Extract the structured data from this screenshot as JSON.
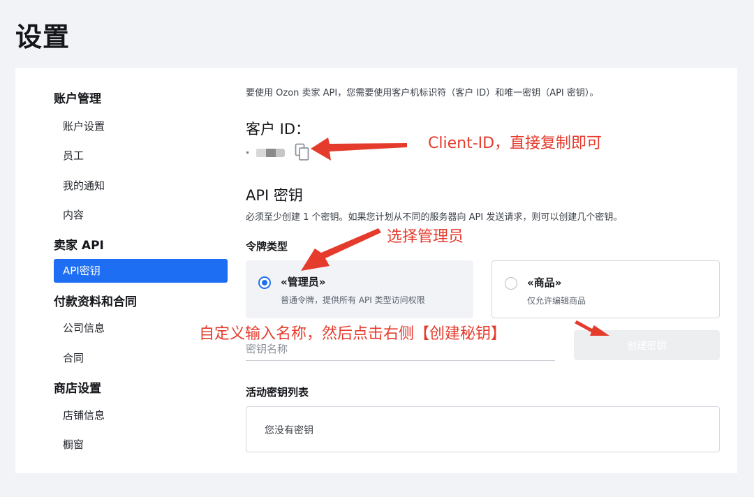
{
  "page_title": "设置",
  "sidebar": {
    "sections": [
      {
        "label": "账户管理",
        "items": [
          "账户设置",
          "员工",
          "我的通知",
          "内容"
        ]
      },
      {
        "label": "卖家 API",
        "items": [
          "API密钥"
        ]
      },
      {
        "label": "付款资料和合同",
        "items": [
          "公司信息",
          "合同"
        ]
      },
      {
        "label": "商店设置",
        "items": [
          "店铺信息",
          "橱窗"
        ]
      }
    ],
    "active_item": "API密钥"
  },
  "main": {
    "intro": "要使用 Ozon 卖家 API，您需要使用客户机标识符（客户 ID）和唯一密钥（API 密钥）。",
    "client_id_label": "客户 ID：",
    "api_key_title": "API 密钥",
    "api_key_desc": "必须至少创建 1 个密钥。如果您计划从不同的服务器向 API 发送请求，则可以创建几个密钥。",
    "token_type_label": "令牌类型",
    "options": [
      {
        "title": "«管理员»",
        "desc": "普通令牌，提供所有 API 类型访问权限",
        "selected": true
      },
      {
        "title": "«商品»",
        "desc": "仅允许编辑商品",
        "selected": false
      }
    ],
    "key_name_placeholder": "密钥名称",
    "key_name_value": "",
    "create_button_label": "创建密钥",
    "active_keys_title": "活动密钥列表",
    "active_keys_empty": "您没有密钥"
  },
  "annotations": {
    "client_id_note": "Client-ID，直接复制即可",
    "select_admin_note": "选择管理员",
    "create_note": "自定义输入名称，然后点击右侧【创建秘钥】",
    "color": "#e53b2c"
  },
  "colors": {
    "accent": "#1d6ef2",
    "annotation": "#e53b2c"
  }
}
